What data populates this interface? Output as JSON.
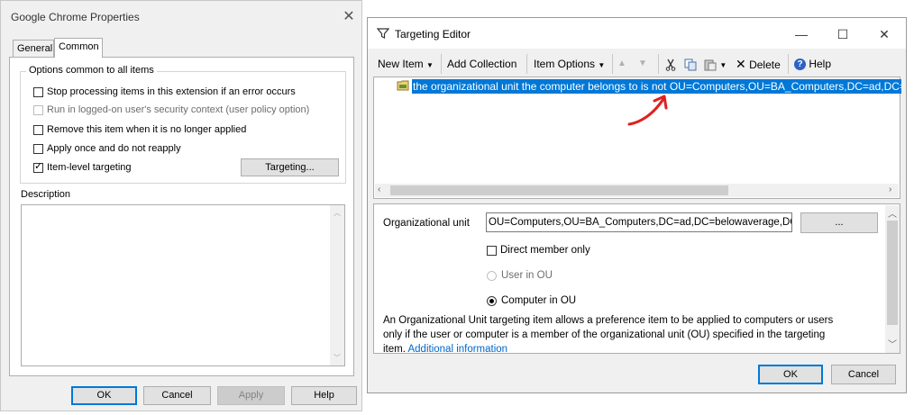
{
  "left_dialog": {
    "title": "Google Chrome Properties",
    "tabs": [
      "General",
      "Common"
    ],
    "active_tab": "Common",
    "group_title": "Options common to all items",
    "options": [
      {
        "label": "Stop processing items in this extension if an error occurs",
        "checked": false,
        "enabled": true
      },
      {
        "label": "Run in logged-on user's security context (user policy option)",
        "checked": false,
        "enabled": false
      },
      {
        "label": "Remove this item when it is no longer applied",
        "checked": false,
        "enabled": true
      },
      {
        "label": "Apply once and do not reapply",
        "checked": false,
        "enabled": true
      },
      {
        "label": "Item-level targeting",
        "checked": true,
        "enabled": true
      }
    ],
    "targeting_button": "Targeting...",
    "description_label": "Description",
    "description_value": "",
    "buttons": {
      "ok": "OK",
      "cancel": "Cancel",
      "apply": "Apply",
      "help": "Help"
    }
  },
  "right_dialog": {
    "title": "Targeting Editor",
    "toolbar": {
      "new_item": "New Item",
      "add_collection": "Add Collection",
      "item_options": "Item Options",
      "delete": "Delete",
      "help": "Help"
    },
    "tree_item": "the organizational unit the computer belongs to is not OU=Computers,OU=BA_Computers,DC=ad,DC=belowaverage,DC=org",
    "props": {
      "ou_label": "Organizational unit",
      "ou_value": "OU=Computers,OU=BA_Computers,DC=ad,DC=belowaverage,DC=org",
      "browse_button": "...",
      "direct_member_only": "Direct member only",
      "user_in_ou": "User in OU",
      "computer_in_ou": "Computer in OU",
      "selected_option": "Computer in OU",
      "description_line1": "An Organizational Unit targeting item allows a preference item to be applied to computers or users",
      "description_line2": "only if the user or computer is a member of the organizational unit (OU) specified in the targeting",
      "description_line3": "item.",
      "additional_info": "Additional information"
    },
    "buttons": {
      "ok": "OK",
      "cancel": "Cancel"
    }
  },
  "colors": {
    "selection": "#0078d7",
    "annotation_arrow": "#e02020",
    "link": "#0066cc"
  }
}
